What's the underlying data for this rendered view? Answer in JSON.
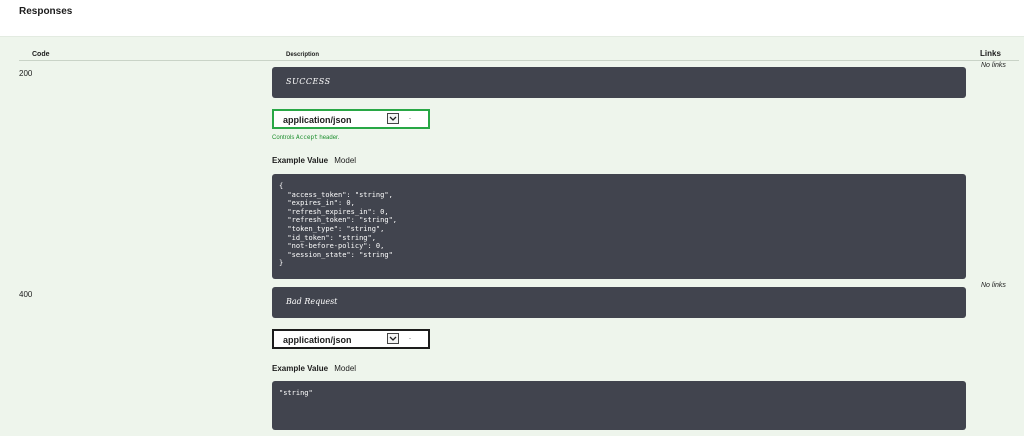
{
  "section": {
    "title": "Responses"
  },
  "table": {
    "headers": {
      "code": "Code",
      "description": "Description",
      "links": "Links"
    }
  },
  "responses": [
    {
      "code": "200",
      "description": "SUCCESS",
      "media_type": "application/json",
      "controls_hint": {
        "prefix": "Controls",
        "code": "Accept",
        "suffix": "header."
      },
      "tabs": {
        "example_value": "Example Value",
        "model": "Model"
      },
      "example": "{\n  \"access_token\": \"string\",\n  \"expires_in\": 0,\n  \"refresh_expires_in\": 0,\n  \"refresh_token\": \"string\",\n  \"token_type\": \"string\",\n  \"id_token\": \"string\",\n  \"not-before-policy\": 0,\n  \"session_state\": \"string\"\n}",
      "links": "No links"
    },
    {
      "code": "400",
      "description": "Bad Request",
      "media_type": "application/json",
      "tabs": {
        "example_value": "Example Value",
        "model": "Model"
      },
      "example": "\"string\"",
      "links": "No links"
    }
  ],
  "colors": {
    "background": "#eef5ec",
    "dark_box": "#41444e",
    "select_active_border": "#28a745",
    "hint_text": "#1e8f2f"
  },
  "icons": {
    "select_arrow": "chevron-down-icon"
  }
}
